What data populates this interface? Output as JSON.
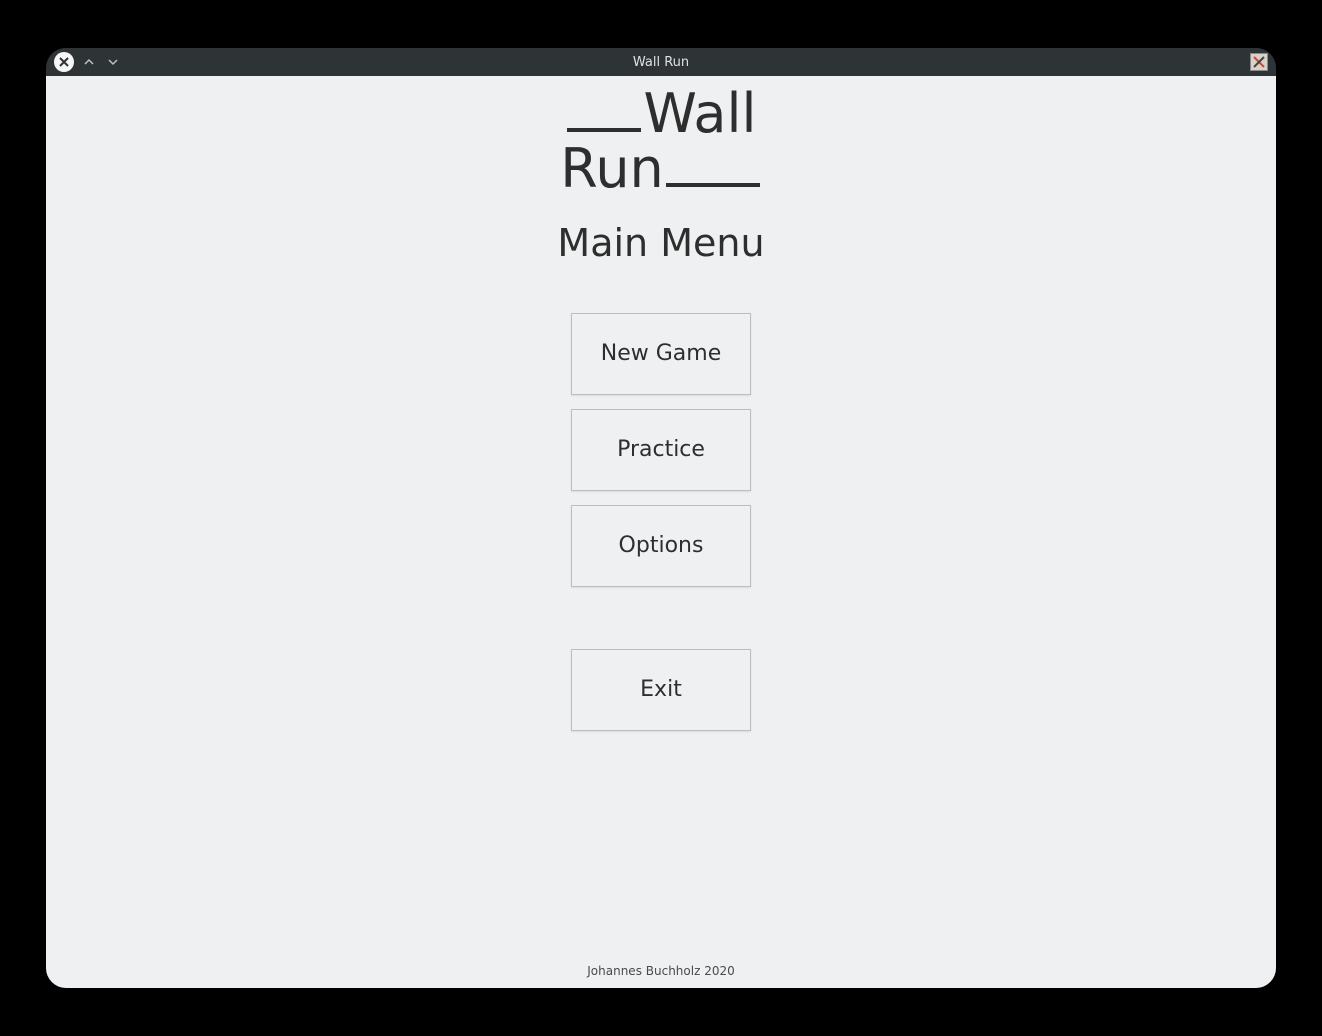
{
  "window": {
    "title": "Wall Run"
  },
  "logo": {
    "line1": "Wall",
    "line2": "Run"
  },
  "menu": {
    "title": "Main Menu",
    "buttons": {
      "new_game": "New Game",
      "practice": "Practice",
      "options": "Options",
      "exit": "Exit"
    }
  },
  "footer": {
    "credit": "Johannes Buchholz 2020"
  }
}
